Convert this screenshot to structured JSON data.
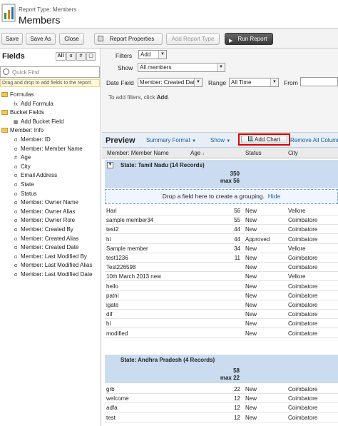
{
  "header": {
    "subtitle": "Report Type: Members",
    "title": "Members"
  },
  "toolbar": {
    "save": "Save",
    "save_as": "Save As",
    "close": "Close",
    "report_properties": "Report Properties",
    "add_report_type": "Add Report Type",
    "run_report": "Run Report"
  },
  "fields": {
    "title": "Fields",
    "filter_buttons": [
      "All",
      "α",
      "#",
      "▢"
    ],
    "search_placeholder": "Quick Find",
    "hint": "Drag and drop to add fields to the report.",
    "tree": [
      {
        "label": "Formulas",
        "kind": "folder",
        "level": 0
      },
      {
        "label": "Add Formula",
        "kind": "formula",
        "level": 1
      },
      {
        "label": "Bucket Fields",
        "kind": "folder",
        "level": 0
      },
      {
        "label": "Add Bucket Field",
        "kind": "bucket",
        "level": 1
      },
      {
        "label": "Member: Info",
        "kind": "folder",
        "level": 0
      },
      {
        "label": "Member: ID",
        "kind": "text",
        "level": 1
      },
      {
        "label": "Member: Member Name",
        "kind": "text",
        "level": 1
      },
      {
        "label": "Age",
        "kind": "number",
        "level": 1
      },
      {
        "label": "City",
        "kind": "text",
        "level": 1
      },
      {
        "label": "Email Address",
        "kind": "text",
        "level": 1
      },
      {
        "label": "State",
        "kind": "text",
        "level": 1
      },
      {
        "label": "Status",
        "kind": "text",
        "level": 1
      },
      {
        "label": "Member: Owner Name",
        "kind": "text",
        "level": 1
      },
      {
        "label": "Member: Owner Alias",
        "kind": "text",
        "level": 1
      },
      {
        "label": "Member: Owner Role",
        "kind": "text",
        "level": 1
      },
      {
        "label": "Member: Created By",
        "kind": "text",
        "level": 1
      },
      {
        "label": "Member: Created Alias",
        "kind": "text",
        "level": 1
      },
      {
        "label": "Member: Created Date",
        "kind": "text",
        "level": 1
      },
      {
        "label": "Member: Last Modified By",
        "kind": "text",
        "level": 1
      },
      {
        "label": "Member: Last Modified Alias",
        "kind": "text",
        "level": 1
      },
      {
        "label": "Member: Last Modified Date",
        "kind": "text",
        "level": 1
      }
    ]
  },
  "filters": {
    "label": "Filters",
    "add": "Add",
    "show_label": "Show",
    "show_value": "All members",
    "date_field_label": "Date Field",
    "date_field_value": "Member: Created Dat",
    "range_label": "Range",
    "range_value": "All Time",
    "from_label": "From",
    "hint_prefix": "To add filters, click ",
    "hint_link": "Add",
    "hint_suffix": "."
  },
  "preview": {
    "title": "Preview",
    "summary_format": "Summary Format",
    "show": "Show",
    "add_chart": "Add Chart",
    "remove_all": "Remove All Columns",
    "columns": [
      "Member: Member Name",
      "Age",
      "Status",
      "City"
    ],
    "drop_text": "Drop a field here to create a grouping.",
    "hide": "Hide"
  },
  "groups": [
    {
      "label": "State: Tamil Nadu (14 Records)",
      "sum": "350",
      "max": "max 56",
      "rows": [
        [
          "Hari",
          "56",
          "New",
          "Vellore"
        ],
        [
          "sample member34",
          "55",
          "New",
          "Coimbatore"
        ],
        [
          "test2",
          "44",
          "New",
          "Coimbatore"
        ],
        [
          "hi",
          "44",
          "Approved",
          "Coimbatore"
        ],
        [
          "Sample member",
          "34",
          "New",
          "Vellore"
        ],
        [
          "test1236",
          "11",
          "New",
          "Coimbatore"
        ],
        [
          "Test226598",
          "",
          "New",
          "Coimbatore"
        ],
        [
          "10th March 2013 new",
          "",
          "New",
          "Vellore"
        ],
        [
          "hello",
          "",
          "New",
          "Coimbatore"
        ],
        [
          "patni",
          "",
          "New",
          "Coimbatore"
        ],
        [
          "igate",
          "",
          "New",
          "Coimbatore"
        ],
        [
          "dif",
          "",
          "New",
          "Coimbatore"
        ],
        [
          "hi",
          "",
          "New",
          "Coimbatore"
        ],
        [
          "modified",
          "",
          "New",
          "Coimbatore"
        ]
      ]
    },
    {
      "label": "State: Andhra Pradesh (4 Records)",
      "sum": "58",
      "max": "max 22",
      "rows": [
        [
          "grb",
          "22",
          "New",
          "Coimbatore"
        ],
        [
          "welcome",
          "12",
          "New",
          "Coimbatore"
        ],
        [
          "adfa",
          "12",
          "New",
          "Coimbatore"
        ],
        [
          "test",
          "12",
          "New",
          "Coimbatore"
        ]
      ]
    }
  ]
}
